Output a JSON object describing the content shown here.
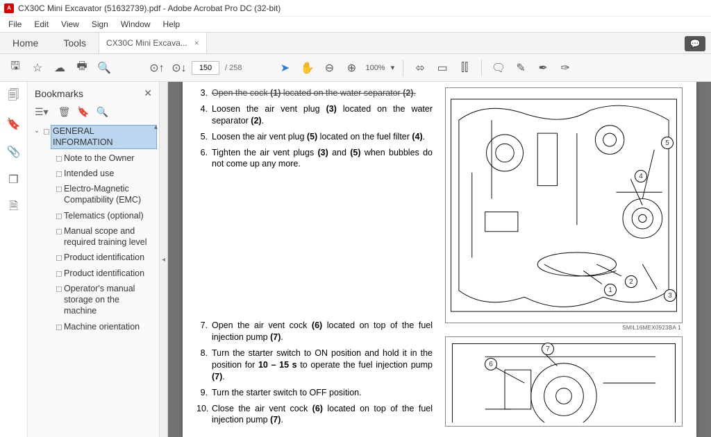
{
  "window": {
    "title": "CX30C Mini Excavator (51632739).pdf - Adobe Acrobat Pro DC (32-bit)"
  },
  "menu": {
    "file": "File",
    "edit": "Edit",
    "view": "View",
    "sign": "Sign",
    "window": "Window",
    "help": "Help"
  },
  "tabs": {
    "home": "Home",
    "tools": "Tools",
    "doc": "CX30C Mini Excava...",
    "close": "×"
  },
  "toolbar": {
    "page_current": "150",
    "page_sep": "/",
    "page_total": "258",
    "zoom": "100%",
    "zoom_caret": "▾"
  },
  "sidebar": {
    "title": "Bookmarks",
    "close": "✕",
    "root": {
      "label": "GENERAL INFORMATION"
    },
    "items": [
      {
        "label": "Note to the Owner"
      },
      {
        "label": "Intended use"
      },
      {
        "label": "Electro-Magnetic Compatibility (EMC)"
      },
      {
        "label": "Telematics (optional)"
      },
      {
        "label": "Manual scope and required training level"
      },
      {
        "label": "Product identification"
      },
      {
        "label": "Product identification"
      },
      {
        "label": "Operator's manual storage on the machine"
      },
      {
        "label": "Machine orientation"
      }
    ]
  },
  "doc": {
    "steps_a": [
      {
        "n": "3.",
        "t": "Open the cock (1) located on the water separator (2)."
      },
      {
        "n": "4.",
        "t": "Loosen the air vent plug (3) located on the water separator (2)."
      },
      {
        "n": "5.",
        "t": "Loosen the air vent plug (5) located on the fuel filter (4)."
      },
      {
        "n": "6.",
        "t": "Tighten the air vent plugs (3) and (5) when bubbles do not come up any more."
      }
    ],
    "steps_b": [
      {
        "n": "7.",
        "t": "Open the air vent cock (6) located on top of the fuel injection pump (7)."
      },
      {
        "n": "8.",
        "t": "Turn the starter switch to ON position and hold it in the position for 10 – 15 s to operate the fuel injection pump (7)."
      },
      {
        "n": "9.",
        "t": "Turn the starter switch to OFF position."
      },
      {
        "n": "10.",
        "t": "Close the air vent cock (6) located on top of the fuel injection pump (7)."
      }
    ],
    "fig1": {
      "callouts": [
        "1",
        "2",
        "3",
        "4",
        "5"
      ],
      "caption": "SMIL16MEX0923BA   1"
    },
    "fig2": {
      "callouts": [
        "6",
        "7"
      ]
    }
  }
}
